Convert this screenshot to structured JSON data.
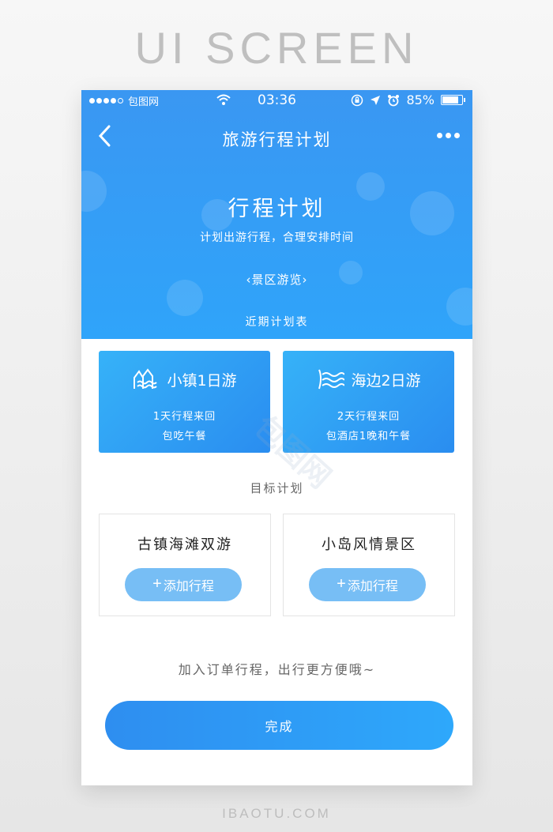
{
  "showcase": {
    "title": "UI SCREEN",
    "footer": "IBAOTU.COM"
  },
  "status_bar": {
    "carrier": "包图网",
    "time": "03:36",
    "battery": "85%"
  },
  "nav": {
    "title": "旅游行程计划",
    "back_icon": "chevron-left-icon",
    "more_icon": "more-dots-icon"
  },
  "hero": {
    "title": "行程计划",
    "subtitle": "计划出游行程，合理安排时间",
    "scenic_link": "景区游览",
    "recent_label": "近期计划表"
  },
  "trips": [
    {
      "title": "小镇1日游",
      "line1": "1天行程来回",
      "line2": "包吃午餐",
      "icon": "town-icon"
    },
    {
      "title": "海边2日游",
      "line1": "2天行程来回",
      "line2": "包酒店1晚和午餐",
      "icon": "wave-icon"
    }
  ],
  "goals": {
    "label": "目标计划",
    "items": [
      {
        "name": "古镇海滩双游",
        "button": "添加行程"
      },
      {
        "name": "小岛风情景区",
        "button": "添加行程"
      }
    ]
  },
  "hint": "加入订单行程，出行更方便哦~",
  "done_button": "完成",
  "watermark": "包图网",
  "colors": {
    "primary": "#2f9bf5",
    "card_button": "#77bef5",
    "text_muted": "#666666"
  }
}
